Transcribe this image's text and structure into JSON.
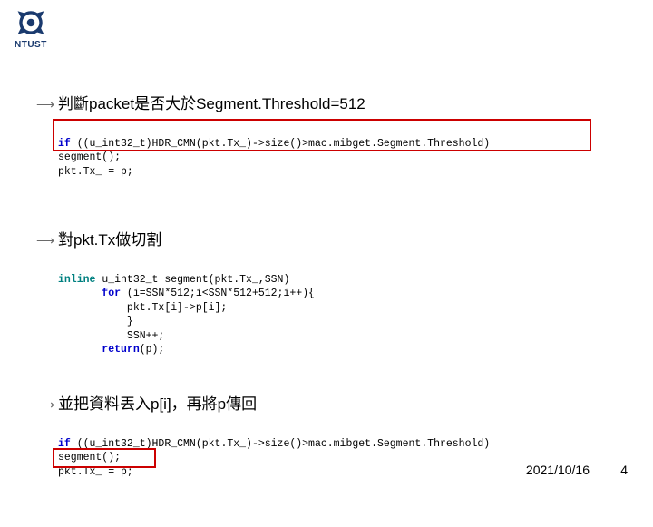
{
  "logo": {
    "text": "NTUST"
  },
  "bullets": {
    "b1": "判斷packet是否大於Segment.Threshold=512",
    "b2": "對pkt.Tx做切割",
    "b3": "並把資料丟入p[i]，再將p傳回"
  },
  "code1": {
    "l1a": "if",
    "l1b": " ((u_int32_t)HDR_CMN(pkt.Tx_)->size()>mac.mibget.Segment.Threshold)",
    "l2": "segment();",
    "l3": "pkt.Tx_ = p;"
  },
  "code2": {
    "l1a": "inline",
    "l1b": " u_int32_t segment(pkt.Tx_,SSN)",
    "l2a": "       for",
    "l2b": " (i=SSN*512;i<SSN*512+512;i++){",
    "l3": "           pkt.Tx[i]->p[i];",
    "l4": "           }",
    "l5": "           SSN++;",
    "l6a": "       return",
    "l6b": "(p);"
  },
  "code3": {
    "l1a": "if",
    "l1b": " ((u_int32_t)HDR_CMN(pkt.Tx_)->size()>mac.mibget.Segment.Threshold)",
    "l2": "segment();",
    "l3": "pkt.Tx_ = p;"
  },
  "footer": {
    "date": "2021/10/16",
    "page": "4"
  }
}
